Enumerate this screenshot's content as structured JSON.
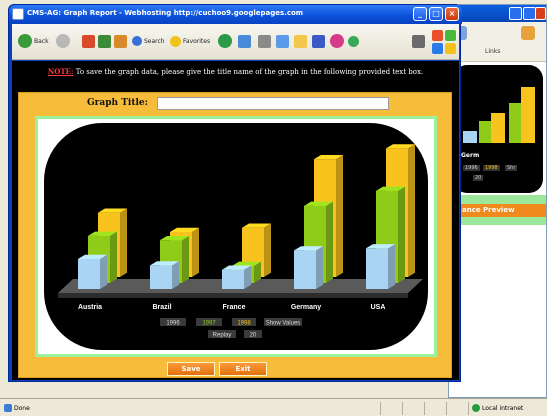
{
  "window": {
    "title": "CMS-AG: Graph Report - Webhosting http://cuchoo9.googlepages.com"
  },
  "toolbar": {
    "back_label": "Back",
    "search_label": "Search",
    "favorites_label": "Favorites"
  },
  "notice": {
    "label": "NOTE:",
    "text": " To save the graph data, please give the title name of the graph in the following provided text box."
  },
  "graph_title": {
    "label": "Graph Title:",
    "value": "",
    "placeholder": ""
  },
  "buttons": {
    "save": "Save",
    "exit": "Exit"
  },
  "controls": {
    "year1": "1996",
    "year2": "1997",
    "year3": "1998",
    "show_values": "Show Values",
    "replay": "Replay",
    "speed": "20"
  },
  "bg_window": {
    "links_label": "Links",
    "preview_button": "ance Preview",
    "caption": "Germ",
    "pills": [
      "1996",
      "1998",
      "Shr"
    ],
    "pill2": "20"
  },
  "status": {
    "left": "Done",
    "right": "Local intranet"
  },
  "colors": {
    "series_1996": "#aad4f4",
    "series_1997": "#8fcc1a",
    "series_1998": "#f8c31d",
    "frame": "#9cf29a",
    "panel": "#f7bd3a",
    "button": "#f08a1c"
  },
  "chart_data": {
    "type": "bar",
    "categories": [
      "Austria",
      "Brazil",
      "France",
      "Germany",
      "USA"
    ],
    "series": [
      {
        "name": "1996",
        "values": [
          14,
          11,
          9,
          18,
          19
        ]
      },
      {
        "name": "1997",
        "values": [
          22,
          20,
          8,
          36,
          43
        ]
      },
      {
        "name": "1998",
        "values": [
          30,
          21,
          23,
          55,
          60
        ]
      }
    ],
    "title": "",
    "xlabel": "",
    "ylabel": "",
    "ylim": [
      0,
      70
    ],
    "grid": false,
    "legend": "bottom"
  }
}
